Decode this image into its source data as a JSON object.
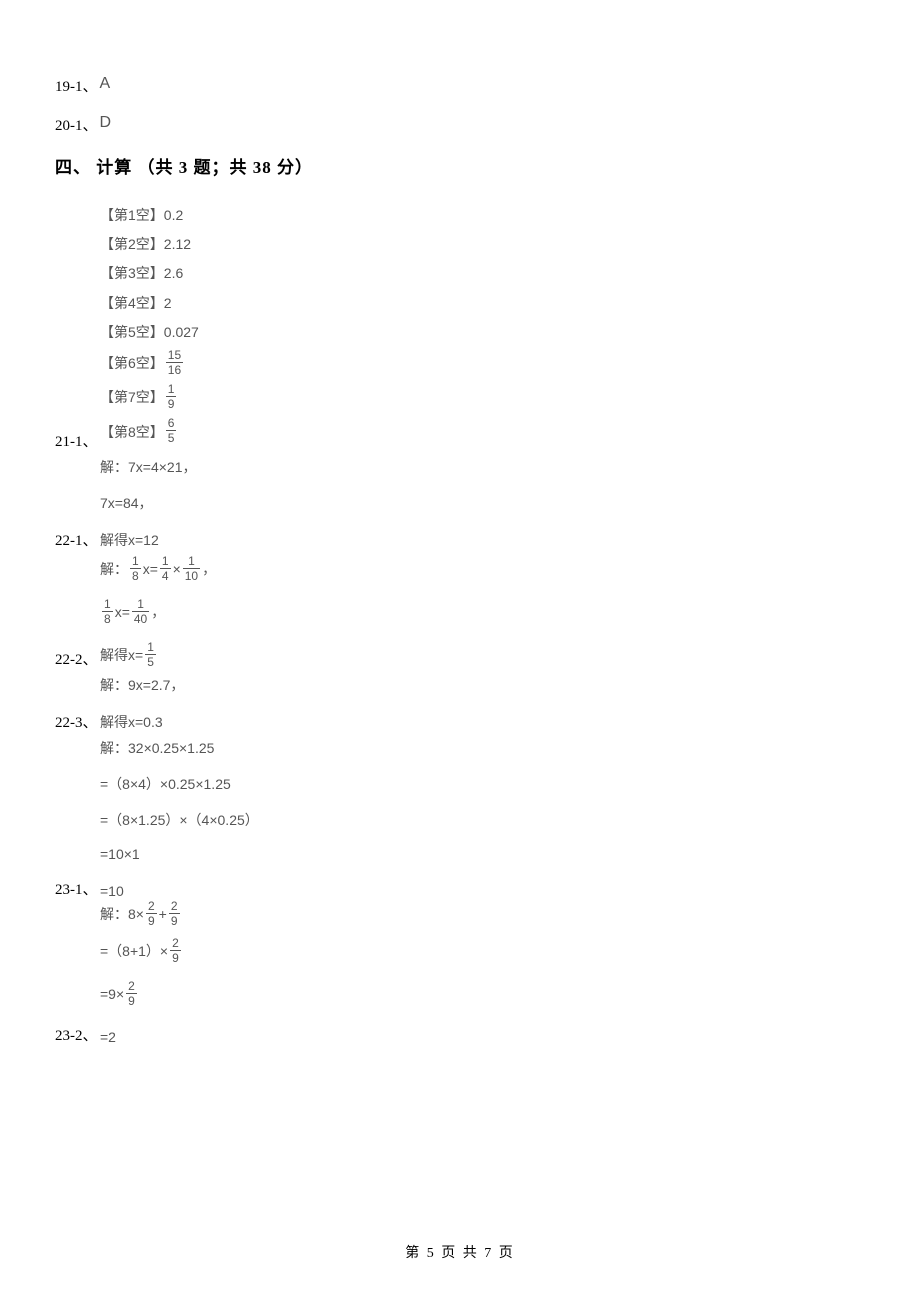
{
  "answers": {
    "a19": {
      "label": "19-1、",
      "value": "A"
    },
    "a20": {
      "label": "20-1、",
      "value": "D"
    }
  },
  "section4": {
    "heading": "四、 计算 （共 3 题；共 38 分）"
  },
  "q21": {
    "label": "21-1、",
    "blanks": {
      "b1": "【第1空】0.2",
      "b2": "【第2空】2.12",
      "b3": "【第3空】2.6",
      "b4": "【第4空】2",
      "b5": "【第5空】0.027",
      "b6_prefix": "【第6空】",
      "b6_num": "15",
      "b6_den": "16",
      "b7_prefix": "【第7空】",
      "b7_num": "1",
      "b7_den": "9",
      "b8_prefix": "【第8空】",
      "b8_num": "6",
      "b8_den": "5"
    }
  },
  "q22_1": {
    "label": "22-1、",
    "line1": "解：7x=4×21，",
    "line2": "7x=84，",
    "line3": "解得x=12"
  },
  "q22_2": {
    "label": "22-2、",
    "s1_pre": "解：",
    "s1_f1n": "1",
    "s1_f1d": "8",
    "s1_mid1": " x= ",
    "s1_f2n": "1",
    "s1_f2d": "4",
    "s1_mid2": " × ",
    "s1_f3n": "1",
    "s1_f3d": "10",
    "s1_end": "  ，",
    "s2_f1n": "1",
    "s2_f1d": "8",
    "s2_mid": " x= ",
    "s2_f2n": "1",
    "s2_f2d": "40",
    "s2_end": "  ，",
    "s3_pre": "解得x= ",
    "s3_fn": "1",
    "s3_fd": "5"
  },
  "q22_3": {
    "label": "22-3、",
    "line1": "解：9x=2.7，",
    "line2": "解得x=0.3"
  },
  "q23_1": {
    "label": "23-1、",
    "line1": "解：32×0.25×1.25",
    "line2": "=（8×4）×0.25×1.25",
    "line3": "=（8×1.25）×（4×0.25）",
    "line4": "=10×1",
    "line5": "=10"
  },
  "q23_2": {
    "label": "23-2、",
    "s1_pre": "解：8× ",
    "s1_f1n": "2",
    "s1_f1d": "9",
    "s1_mid": " + ",
    "s1_f2n": "2",
    "s1_f2d": "9",
    "s2_pre": "=（8+1）× ",
    "s2_fn": "2",
    "s2_fd": "9",
    "s3_pre": "=9× ",
    "s3_fn": "2",
    "s3_fd": "9",
    "s4": "=2"
  },
  "footer": "第 5 页 共 7 页"
}
